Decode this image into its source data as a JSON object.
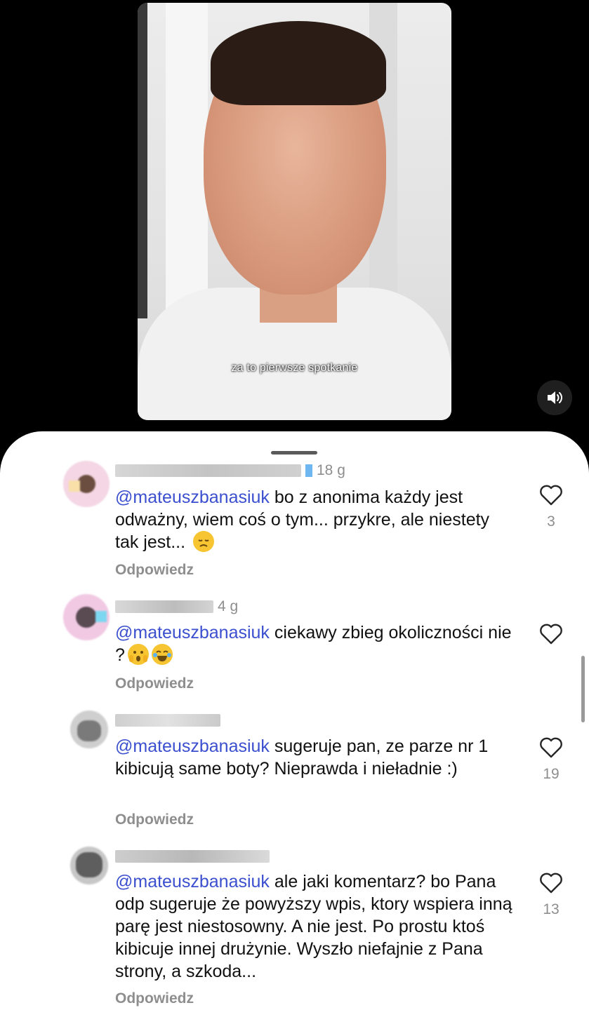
{
  "video": {
    "subtitle": "za to pierwsze spotkanie",
    "sound_icon": "speaker-icon"
  },
  "comments": [
    {
      "time": "18 g",
      "mention": "@mateuszbanasiuk",
      "text": " bo z anonima każdy jest odważny, wiem coś o tym... przykre, ale niestety tak jest... ",
      "emoji": "disappointed-face",
      "reply": "Odpowiedz",
      "likes": "3"
    },
    {
      "time": "4 g",
      "mention": "@mateuszbanasiuk",
      "text": " ciekawy zbieg okoliczności nie ?",
      "emoji": "shocked-face, laughing-face",
      "reply": "Odpowiedz",
      "likes": ""
    },
    {
      "time": "",
      "mention": "@mateuszbanasiuk",
      "text": " sugeruje pan, ze parze nr 1 kibicują same boty? Nieprawda i nieładnie :)",
      "reply": "Odpowiedz",
      "likes": "19"
    },
    {
      "time": "",
      "mention": "@mateuszbanasiuk",
      "text": " ale jaki komentarz? bo Pana odp sugeruje że powyższy wpis, ktory wspiera inną parę jest niestosowny. A nie jest. Po prostu ktoś kibicuje innej drużynie. Wyszło niefajnie z Pana strony, a szkoda...",
      "reply": "Odpowiedz",
      "likes": "13"
    }
  ],
  "colors": {
    "mention": "#3b4fcf",
    "secondary_text": "#8e8e8e"
  }
}
